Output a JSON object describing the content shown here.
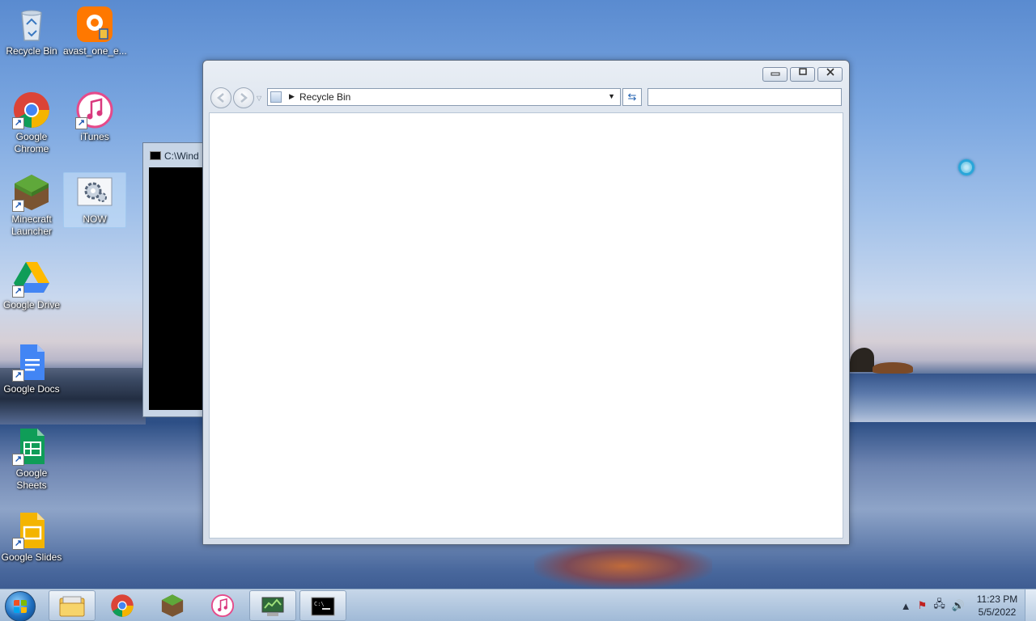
{
  "desktop": {
    "icons": [
      {
        "label": "Recycle Bin",
        "icon": "recycle-bin-icon"
      },
      {
        "label": "avast_one_e...",
        "icon": "avast-icon"
      },
      {
        "label": "Google Chrome",
        "icon": "chrome-icon"
      },
      {
        "label": "iTunes",
        "icon": "itunes-icon"
      },
      {
        "label": "Minecraft Launcher",
        "icon": "minecraft-icon"
      },
      {
        "label": "NOW",
        "icon": "settings-gear-icon"
      },
      {
        "label": "Google Drive",
        "icon": "google-drive-icon"
      },
      {
        "label": "Google Docs",
        "icon": "google-docs-icon"
      },
      {
        "label": "Google Sheets",
        "icon": "google-sheets-icon"
      },
      {
        "label": "Google Slides",
        "icon": "google-slides-icon"
      }
    ]
  },
  "console_window": {
    "title": "C:\\Wind"
  },
  "explorer": {
    "address_path": "Recycle Bin",
    "search_placeholder": "",
    "caption": {
      "minimize": "▭",
      "maximize": "□",
      "close": "✕"
    }
  },
  "taskbar": {
    "items": [
      "windows-explorer-icon",
      "chrome-icon",
      "minecraft-icon",
      "itunes-icon",
      "control-panel-icon",
      "command-prompt-icon"
    ],
    "clock": {
      "time": "11:23 PM",
      "date": "5/5/2022"
    }
  },
  "colors": {
    "accent": "#1f6fc0",
    "window_frame": "#dfe6ef",
    "busy_cursor": "#29a6d9"
  }
}
